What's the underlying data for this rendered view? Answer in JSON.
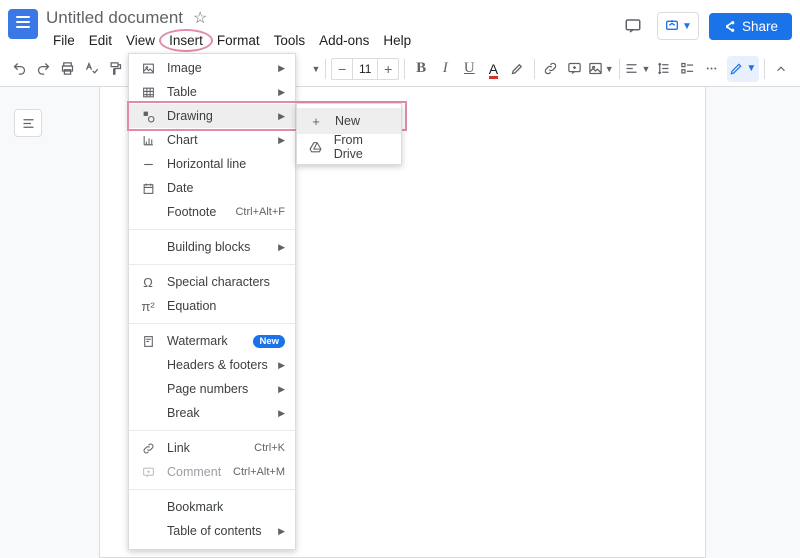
{
  "header": {
    "doc_title": "Untitled document",
    "menus": [
      "File",
      "Edit",
      "View",
      "Insert",
      "Format",
      "Tools",
      "Add-ons",
      "Help"
    ],
    "share_label": "Share"
  },
  "toolbar": {
    "font_size": "11"
  },
  "insert_menu": {
    "image": "Image",
    "table": "Table",
    "drawing": "Drawing",
    "chart": "Chart",
    "horizontal_line": "Horizontal line",
    "date": "Date",
    "footnote": "Footnote",
    "footnote_shortcut": "Ctrl+Alt+F",
    "building_blocks": "Building blocks",
    "special_characters": "Special characters",
    "equation": "Equation",
    "watermark": "Watermark",
    "watermark_badge": "New",
    "headers_footers": "Headers & footers",
    "page_numbers": "Page numbers",
    "break": "Break",
    "link": "Link",
    "link_shortcut": "Ctrl+K",
    "comment": "Comment",
    "comment_shortcut": "Ctrl+Alt+M",
    "bookmark": "Bookmark",
    "table_of_contents": "Table of contents"
  },
  "drawing_submenu": {
    "new": "New",
    "from_drive": "From Drive"
  }
}
